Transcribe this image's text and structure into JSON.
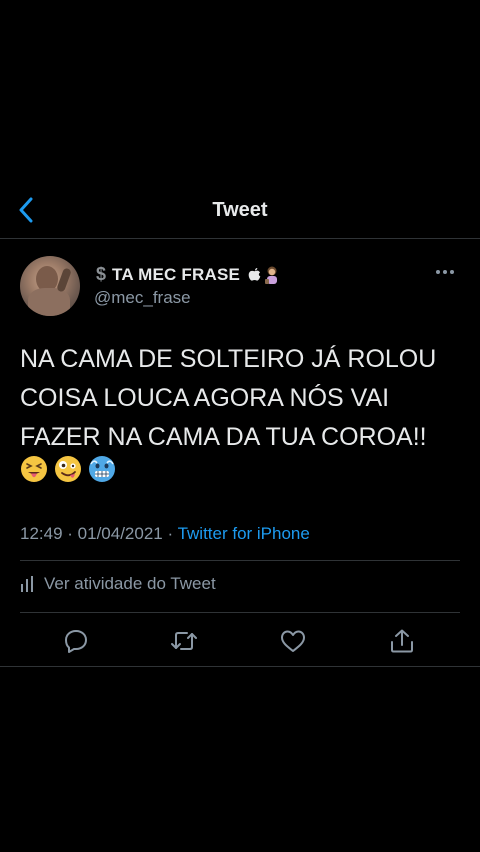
{
  "header": {
    "title": "Tweet"
  },
  "tweet": {
    "display_name": "TA MEC FRASE",
    "handle": "@mec_frase",
    "text_lines": [
      "NA CAMA DE SOLTEIRO JÁ ROLOU",
      "COISA LOUCA AGORA NÓS VAI",
      "FAZER NA CAMA DA TUA COROA!!"
    ],
    "emojis": [
      "squinting-tongue-emoji",
      "zany-face-emoji",
      "cold-face-emoji"
    ],
    "time": "12:49",
    "separator": " · ",
    "date": "01/04/2021",
    "client": "Twitter for iPhone",
    "activity_label": "Ver atividade do Tweet"
  },
  "colors": {
    "background": "#000000",
    "text": "#e7e9ea",
    "secondary": "#8b98a5",
    "accent": "#1d9bf0",
    "divider": "#2f3336"
  },
  "icons": {
    "back": "chevron-left-icon",
    "more": "ellipsis-icon",
    "reply": "reply-icon",
    "retweet": "retweet-icon",
    "like": "heart-icon",
    "share": "share-icon",
    "activity": "bar-chart-icon"
  }
}
